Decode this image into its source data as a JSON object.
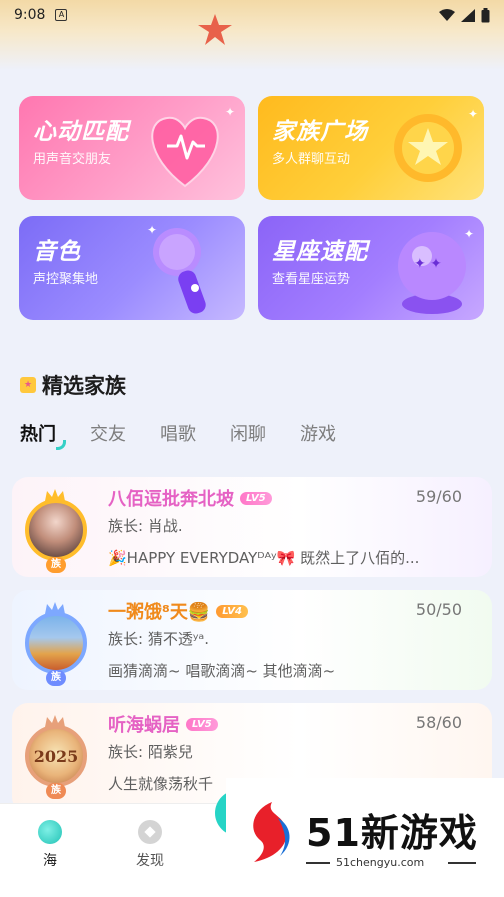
{
  "status_bar": {
    "time": "9:08",
    "notification_icon": "A"
  },
  "feature_cards": [
    {
      "title": "心动匹配",
      "subtitle": "用声音交朋友",
      "icon": "heart-icon"
    },
    {
      "title": "家族广场",
      "subtitle": "多人群聊互动",
      "icon": "star-shield-icon"
    },
    {
      "title": "音色",
      "subtitle": "声控聚集地",
      "icon": "microphone-icon"
    },
    {
      "title": "星座速配",
      "subtitle": "查看星座运势",
      "icon": "crystal-ball-icon"
    }
  ],
  "section": {
    "title": "精选家族"
  },
  "tabs": [
    {
      "label": "热门",
      "active": true
    },
    {
      "label": "交友",
      "active": false
    },
    {
      "label": "唱歌",
      "active": false
    },
    {
      "label": "闲聊",
      "active": false
    },
    {
      "label": "游戏",
      "active": false
    }
  ],
  "families": [
    {
      "name": "八佰逗批奔北坡",
      "level": "LV5",
      "count": "59/60",
      "leader": "族长: 肖战.",
      "desc": "🎉HAPPY EVERYDAYᴰᴬʸ🎀    既然上了八佰的...",
      "tag": "族"
    },
    {
      "name": "一粥饿⁸天🍔",
      "level": "LV4",
      "count": "50/50",
      "leader": "族长: 猜不透ʸᵃ.",
      "desc": "画猜滴滴~ 唱歌滴滴~ 其他滴滴~",
      "tag": "族"
    },
    {
      "name": "听海蜗居",
      "level": "LV5",
      "count": "58/60",
      "leader": "族长: 陌紫兒",
      "desc": "人生就像荡秋千",
      "tag": "族",
      "avatar_text": "2025"
    }
  ],
  "bottom_nav": [
    {
      "label": "海",
      "icon": "sea-icon",
      "active": true
    },
    {
      "label": "发现",
      "icon": "discover-icon",
      "active": false
    }
  ],
  "watermark": {
    "text": "51新游戏",
    "url": "51chengyu.com"
  },
  "colors": {
    "accent": "#26d4c6",
    "pink": "#e562c4",
    "orange": "#f08a1c"
  }
}
